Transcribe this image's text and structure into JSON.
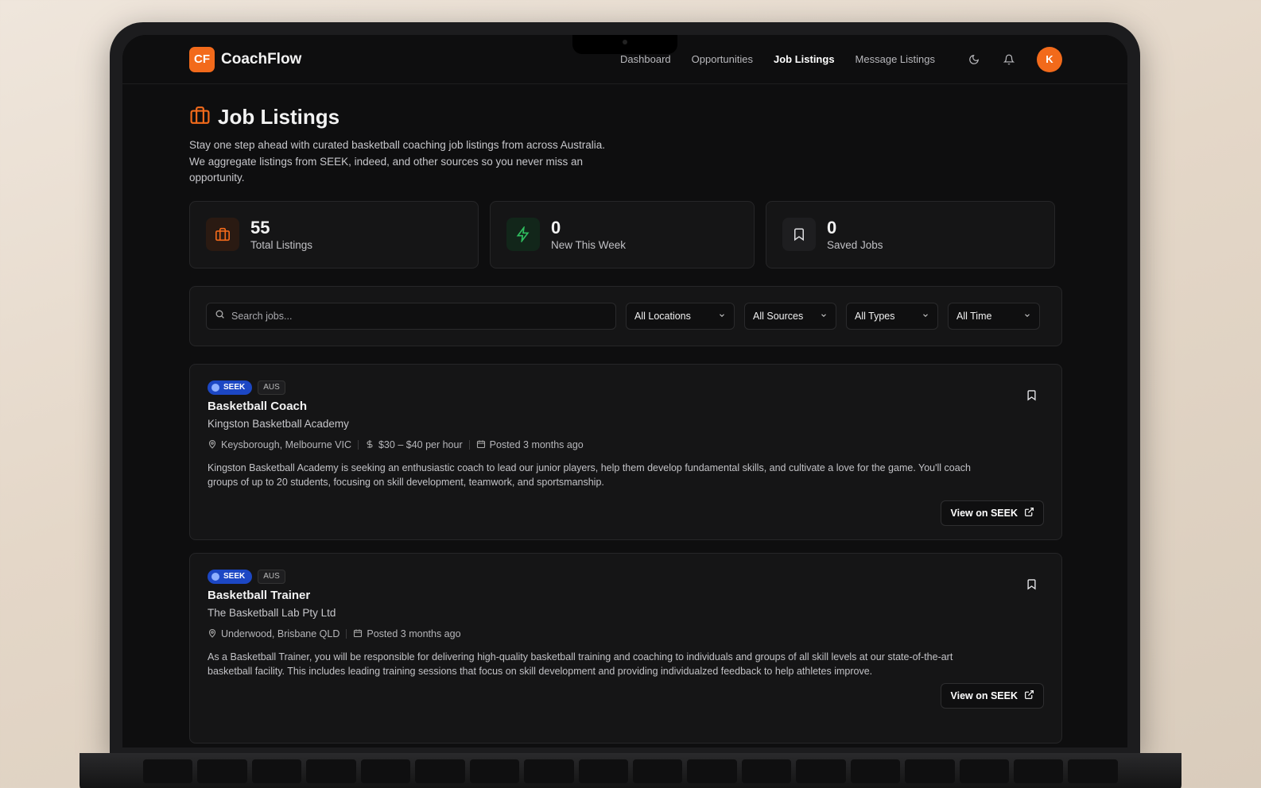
{
  "brand": {
    "mark": "CF",
    "name": "CoachFlow",
    "accent": "#f26a1b"
  },
  "nav": {
    "links": [
      "Dashboard",
      "Opportunities",
      "Job Listings",
      "Message Listings"
    ],
    "active": "Job Listings",
    "icons": [
      "moon-icon",
      "bell-icon"
    ],
    "avatar_initial": "K"
  },
  "page": {
    "title": "Job Listings",
    "subtitle": "Stay one step ahead with curated basketball coaching job listings from across Australia. We aggregate listings from SEEK, indeed, and other sources so you never miss an opportunity."
  },
  "stats": [
    {
      "value": "55",
      "label": "Total Listings",
      "icon": "briefcase-icon"
    },
    {
      "value": "0",
      "label": "New This Week",
      "icon": "lightning-icon"
    },
    {
      "value": "0",
      "label": "Saved Jobs",
      "icon": "bookmark-icon"
    }
  ],
  "filters": {
    "search_placeholder": "Search jobs...",
    "location": "All Locations",
    "source": "All Sources",
    "type": "All Types",
    "time": "All Time"
  },
  "jobs": [
    {
      "source": "SEEK",
      "country": "AUS",
      "title": "Basketball Coach",
      "company": "Kingston Basketball Academy",
      "location": "Keysborough, Melbourne VIC",
      "salary": "$30 – $40 per hour",
      "posted": "Posted 3 months ago",
      "description": "Kingston Basketball Academy is seeking an enthusiastic coach to lead our junior players, help them develop fundamental skills, and cultivate a love for the game. You'll coach groups of up to 20 students, focusing on skill development, teamwork, and sportsmanship.",
      "action": "View on SEEK"
    },
    {
      "source": "SEEK",
      "country": "AUS",
      "title": "Basketball Trainer",
      "company": "The Basketball Lab Pty Ltd",
      "location": "Underwood, Brisbane QLD",
      "posted": "Posted 3 months ago",
      "description": "As a Basketball Trainer, you will be responsible for delivering high-quality basketball training and coaching to individuals and groups of all skill levels at our state-of-the-art basketball facility. This includes leading training sessions that focus on skill development and providing individualzed feedback to help athletes improve.",
      "action": "View on SEEK"
    }
  ]
}
